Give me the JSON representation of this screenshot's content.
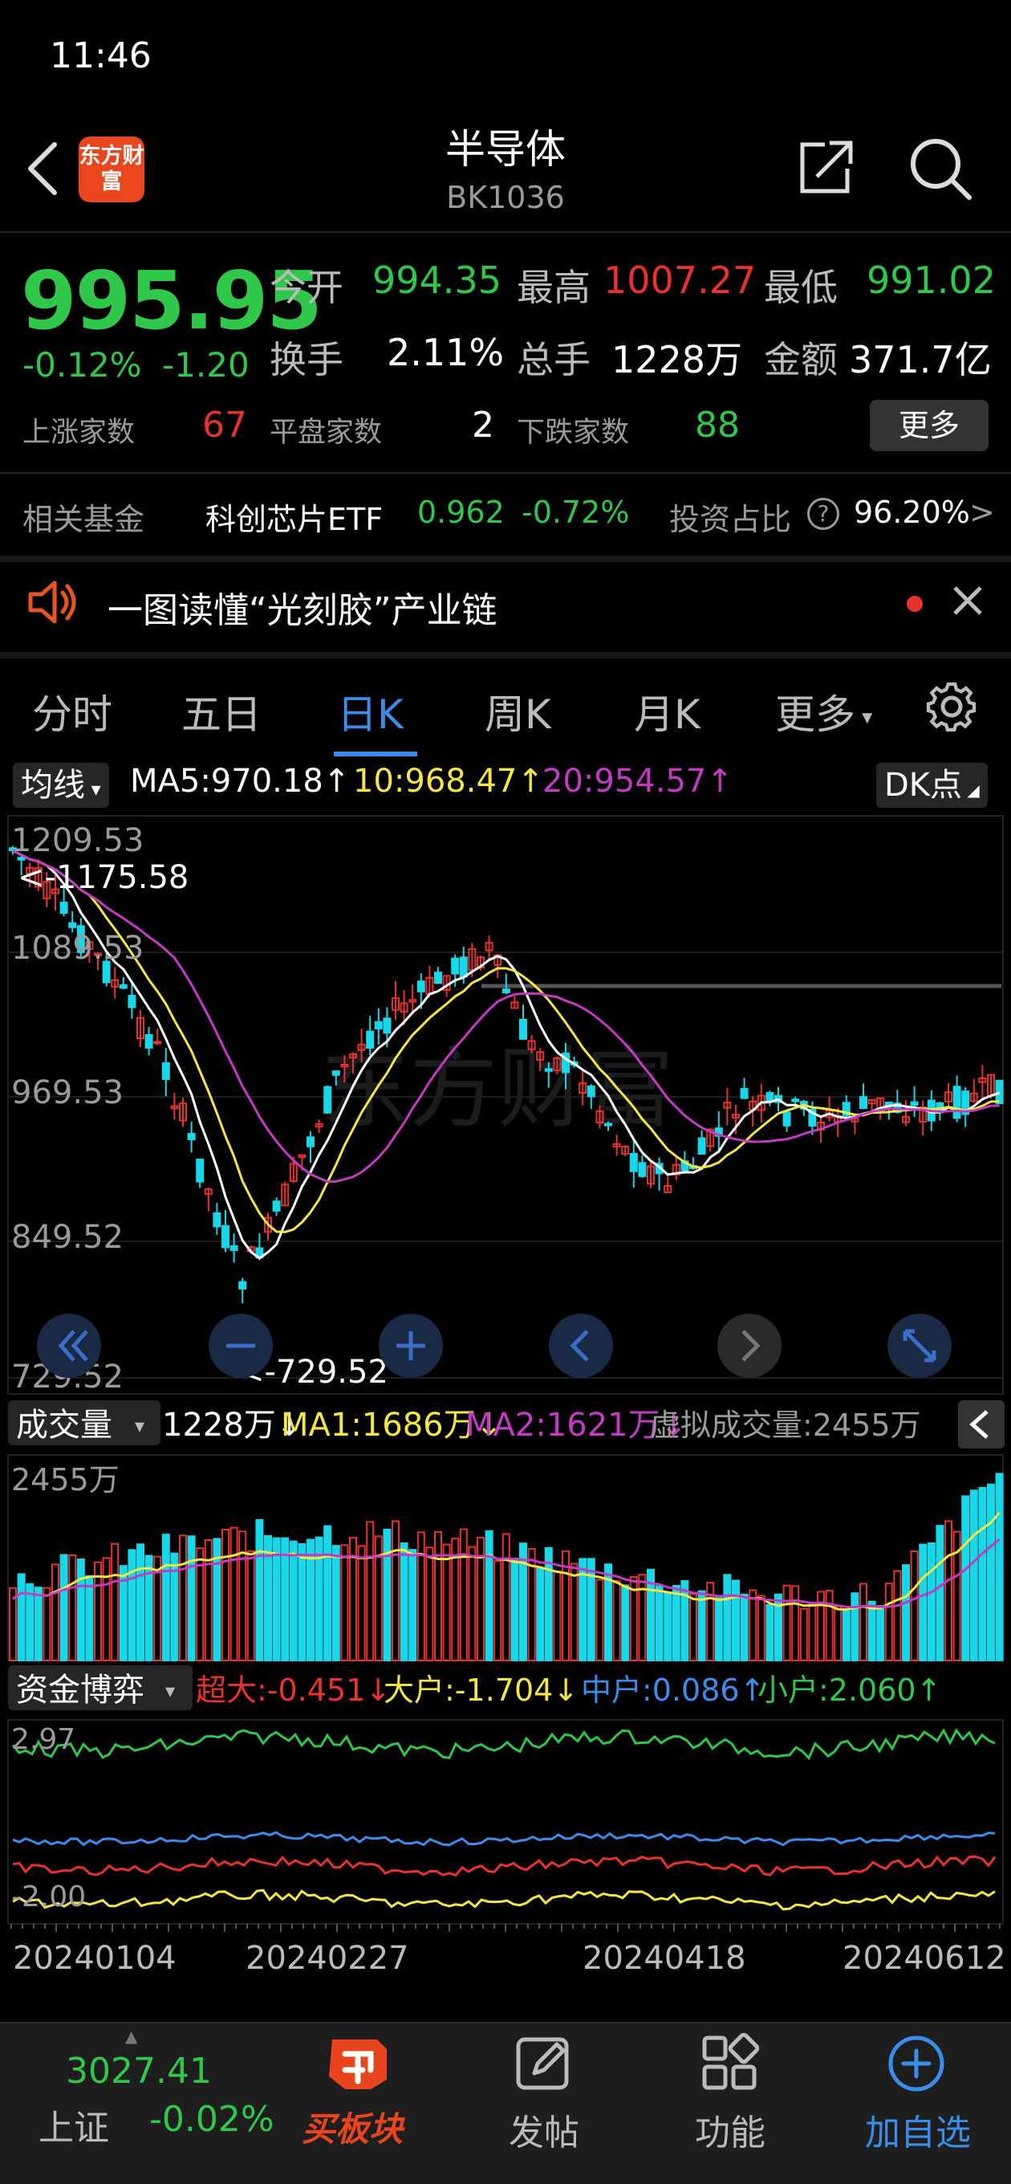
{
  "status": {
    "time": "11:46"
  },
  "header": {
    "logo_text": "东方财富",
    "title": "半导体",
    "code": "BK1036"
  },
  "quote": {
    "price": "995.95",
    "change_pct": "-0.12%",
    "change_amt": "-1.20",
    "open_label": "今开",
    "open": "994.35",
    "high_label": "最高",
    "high": "1007.27",
    "low_label": "最低",
    "low": "991.02",
    "turnover_label": "换手",
    "turnover": "2.11%",
    "volume_label": "总手",
    "volume": "1228万",
    "amount_label": "金额",
    "amount": "371.7亿",
    "up_label": "上涨家数",
    "up": "67",
    "flat_label": "平盘家数",
    "flat": "2",
    "down_label": "下跌家数",
    "down": "88",
    "more_label": "更多"
  },
  "fund": {
    "label": "相关基金",
    "name": "科创芯片ETF",
    "price": "0.962",
    "change": "-0.72%",
    "ratio_label": "投资占比",
    "ratio": "96.20%",
    "arrow": ">"
  },
  "news": {
    "text": "一图读懂“光刻胶”产业链"
  },
  "tabs": [
    {
      "label": "分时"
    },
    {
      "label": "五日"
    },
    {
      "label": "日K"
    },
    {
      "label": "周K"
    },
    {
      "label": "月K"
    },
    {
      "label": "更多"
    }
  ],
  "ma_bar": {
    "selector": "均线",
    "ma5": "MA5:970.18↑",
    "ma10": "10:968.47↑",
    "ma20": "20:954.57↑",
    "dk_label": "DK点"
  },
  "kline": {
    "y_ticks": [
      "1209.53",
      "1089.53",
      "969.53",
      "849.52",
      "729.52"
    ],
    "max_annotation": "<-1175.58",
    "min_annotation": "<-729.52",
    "watermark": "东方财富"
  },
  "volume_bar": {
    "selector": "成交量",
    "current": "1228万↓",
    "ma1": "MA1:1686万↓",
    "ma2": "MA2:1621万↓",
    "virtual": "虚拟成交量:2455万",
    "axis_max": "2455万"
  },
  "capital_bar": {
    "selector": "资金博弈",
    "super": "超大:-0.451↓",
    "big": "大户:-1.704↓",
    "mid": "中户:0.086↑",
    "small": "小户:2.060↑",
    "axis_max": "2.97",
    "axis_min": "-2.00"
  },
  "dates": [
    "20240104",
    "20240227",
    "20240418",
    "20240612"
  ],
  "bottom_nav": {
    "index_value": "3027.41",
    "index_name": "上证",
    "index_change": "-0.02%",
    "buy_label": "买板块",
    "post_label": "发帖",
    "func_label": "功能",
    "add_label": "加自选"
  },
  "colors": {
    "up": "#e8322e",
    "down": "#2fc84a",
    "accent": "#3a8eea",
    "ma5": "#ffffff",
    "ma10": "#f5e642",
    "ma20": "#c23bc2"
  }
}
